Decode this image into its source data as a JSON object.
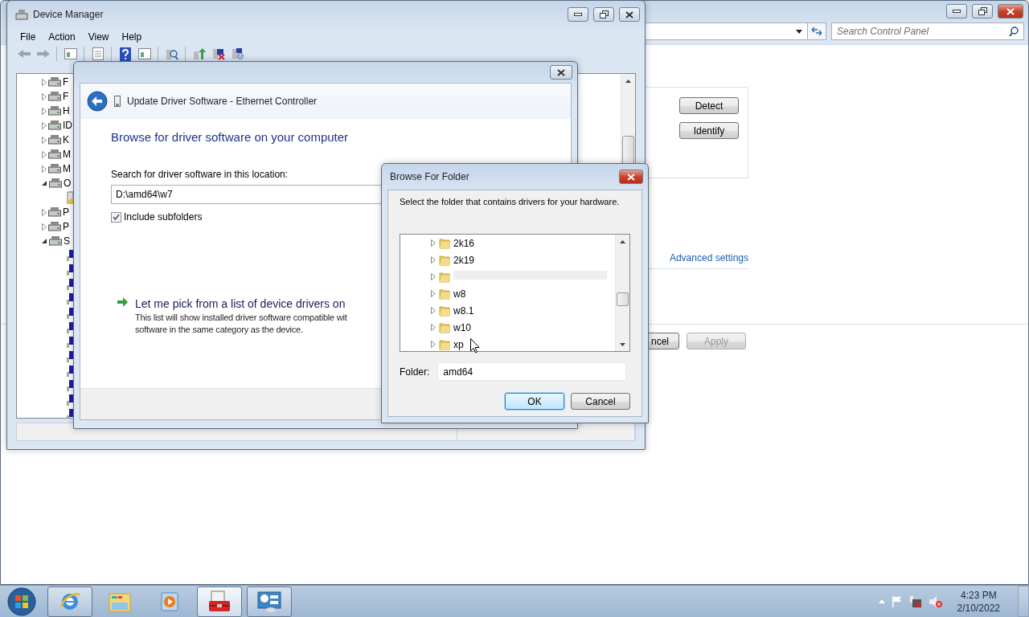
{
  "control_panel": {
    "search": {
      "placeholder": "Search Control Panel"
    },
    "group_buttons": [
      "Detect",
      "Identify"
    ],
    "link": "Advanced settings",
    "footer_buttons": [
      {
        "label": "ncel",
        "disabled": false
      },
      {
        "label": "Apply",
        "disabled": true
      }
    ]
  },
  "device_manager": {
    "title": "Device Manager",
    "menu": [
      "File",
      "Action",
      "View",
      "Help"
    ],
    "tree": [
      {
        "label": "F",
        "expanded": false
      },
      {
        "label": "F",
        "expanded": false
      },
      {
        "label": "H",
        "expanded": false
      },
      {
        "label": "ID",
        "expanded": false
      },
      {
        "label": "K",
        "expanded": false
      },
      {
        "label": "M",
        "expanded": false
      },
      {
        "label": "M",
        "expanded": false
      },
      {
        "label": "O",
        "expanded": true,
        "children": [
          {
            "kind": "warning"
          }
        ]
      },
      {
        "label": "P",
        "expanded": false
      },
      {
        "label": "P",
        "expanded": false
      },
      {
        "label": "S",
        "expanded": true,
        "children": [
          {
            "kind": "device"
          },
          {
            "kind": "device"
          },
          {
            "kind": "device"
          },
          {
            "kind": "device"
          },
          {
            "kind": "device"
          },
          {
            "kind": "device"
          },
          {
            "kind": "device"
          },
          {
            "kind": "device"
          },
          {
            "kind": "device"
          },
          {
            "kind": "device"
          },
          {
            "kind": "device"
          },
          {
            "kind": "device"
          }
        ]
      }
    ]
  },
  "wizard": {
    "title": "Update Driver Software - Ethernet Controller",
    "heading": "Browse for driver software on your computer",
    "location_label": "Search for driver software in this location:",
    "location_value": "D:\\amd64\\w7",
    "include_subfolders": {
      "label": "Include subfolders",
      "checked": true
    },
    "pick_link": {
      "title": "Let me pick from a list of device drivers on",
      "description": [
        "This list will show installed driver software compatible wit",
        "software in the same category as the device."
      ]
    }
  },
  "browse_dialog": {
    "title": "Browse For Folder",
    "instruction": "Select the folder that contains drivers for your hardware.",
    "folders": [
      {
        "label": "2k16",
        "selected": false
      },
      {
        "label": "2k19",
        "selected": false
      },
      {
        "selected": true
      },
      {
        "label": "w8",
        "selected": false
      },
      {
        "label": "w8.1",
        "selected": false
      },
      {
        "label": "w10",
        "selected": false
      },
      {
        "label": "xp",
        "selected": false
      }
    ],
    "folder_label": "Folder:",
    "folder_value": "amd64",
    "buttons": [
      {
        "label": "OK",
        "default": true
      },
      {
        "label": "Cancel",
        "default": false
      }
    ]
  },
  "taskbar": {
    "apps": [
      {
        "kind": "browser",
        "running": true,
        "selected": false
      },
      {
        "kind": "explorer",
        "running": false,
        "selected": false
      },
      {
        "kind": "media",
        "running": false,
        "selected": false
      },
      {
        "kind": "toolbox",
        "running": true,
        "selected": true
      },
      {
        "kind": "control_panel",
        "running": true,
        "selected": false
      }
    ],
    "clock": {
      "time": "4:23 PM",
      "date": "2/10/2022"
    }
  }
}
